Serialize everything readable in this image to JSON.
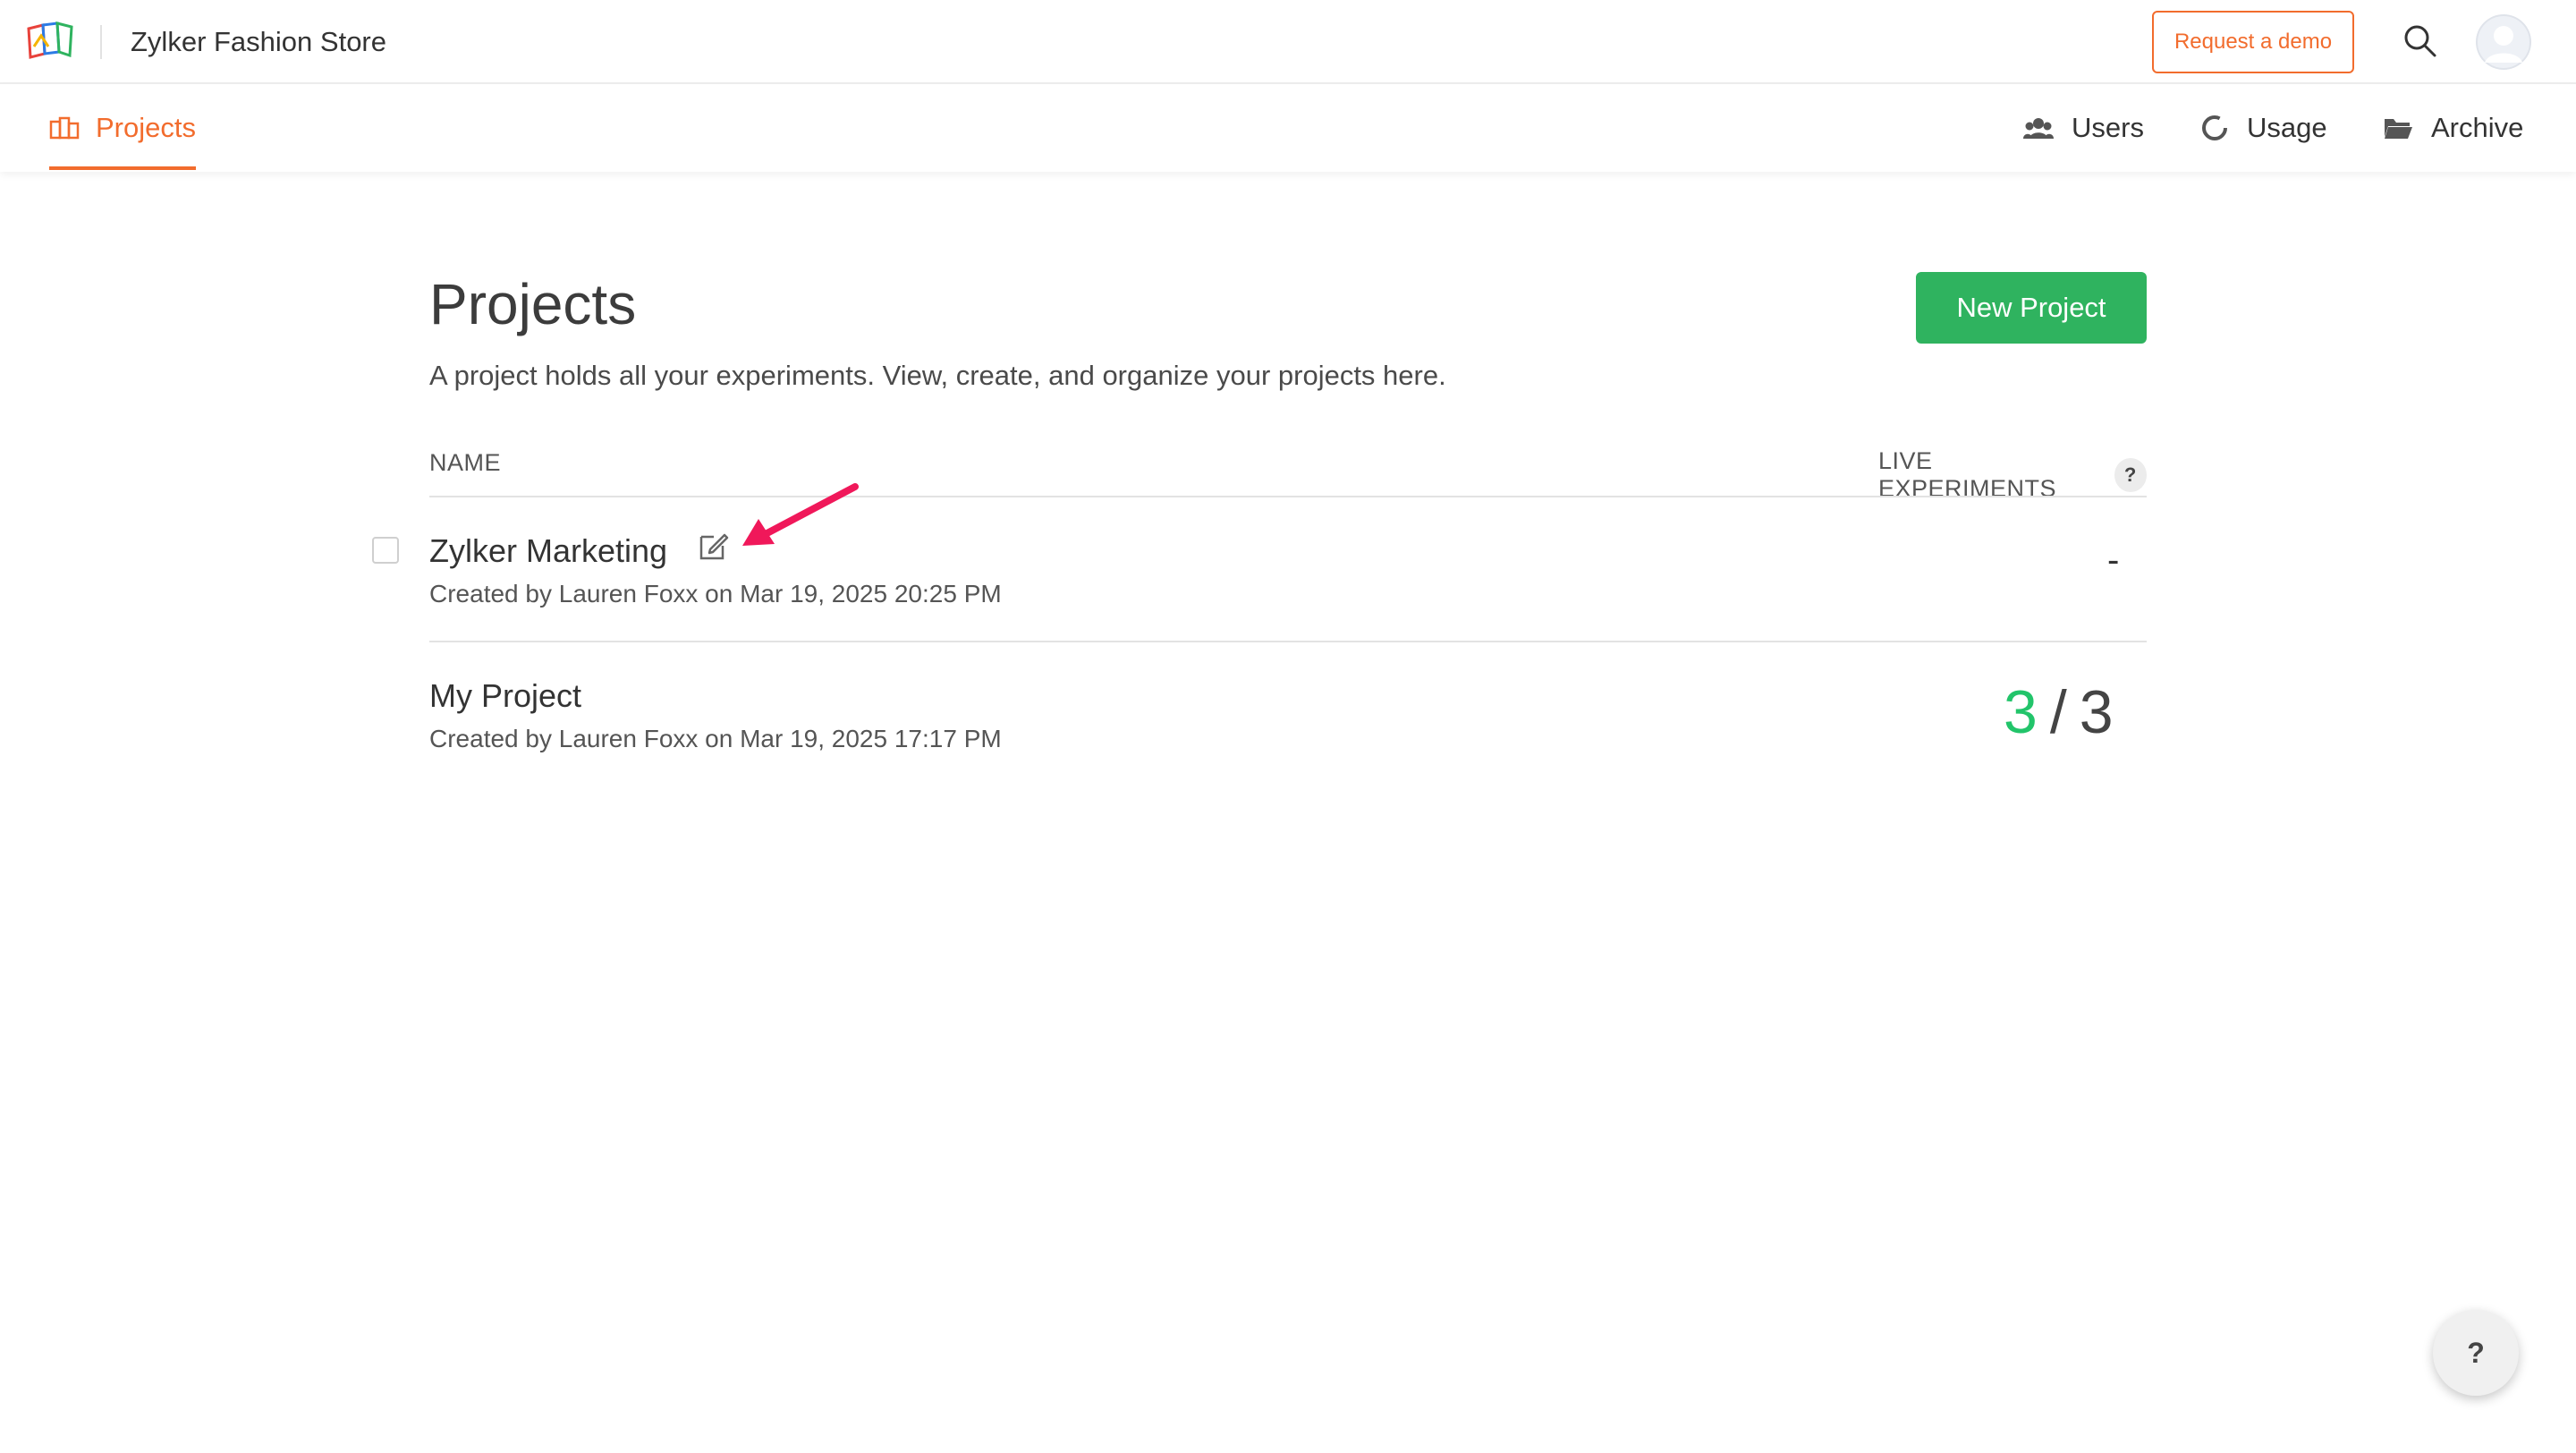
{
  "header": {
    "brand_name": "Zylker Fashion Store",
    "demo_button_label": "Request a demo",
    "search_icon": "search-icon",
    "avatar_icon": "user-avatar-icon"
  },
  "nav": {
    "active_tab": "Projects",
    "right_items": [
      {
        "label": "Users",
        "icon": "users-icon"
      },
      {
        "label": "Usage",
        "icon": "usage-icon"
      },
      {
        "label": "Archive",
        "icon": "folder-icon"
      }
    ]
  },
  "main": {
    "title": "Projects",
    "description": "A project holds all your experiments. View, create, and organize your projects here.",
    "new_project_label": "New Project",
    "columns": {
      "name": "NAME",
      "live": "LIVE EXPERIMENTS",
      "live_help": "?"
    },
    "projects": [
      {
        "name": "Zylker Marketing",
        "meta": "Created by Lauren Foxx on Mar 19, 2025 20:25 PM",
        "live_display": "-"
      },
      {
        "name": "My Project",
        "meta": "Created by Lauren Foxx on Mar 19, 2025 17:17 PM",
        "live_running": "3",
        "live_separator": "/",
        "live_total": "3"
      }
    ]
  },
  "floating_help": "?",
  "colors": {
    "accent": "#f26c2d",
    "primary_button": "#2fb35f",
    "live_green": "#22c46a",
    "annotation_arrow": "#f0185a"
  }
}
